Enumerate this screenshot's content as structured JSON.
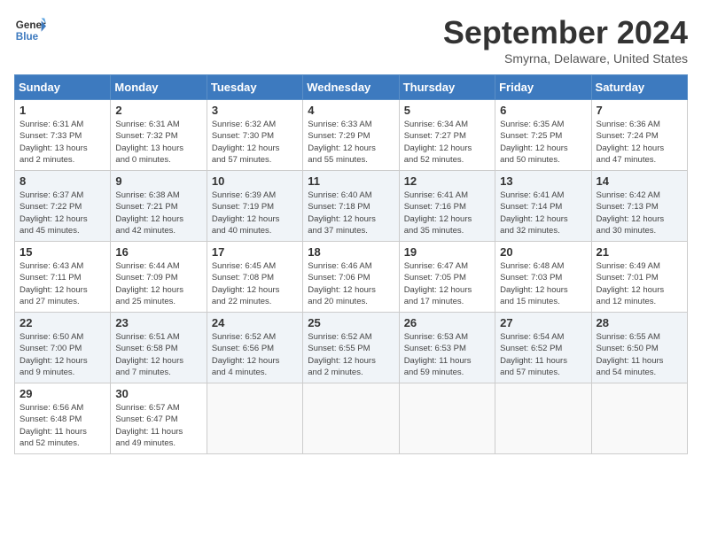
{
  "logo": {
    "line1": "General",
    "line2": "Blue"
  },
  "title": "September 2024",
  "location": "Smyrna, Delaware, United States",
  "days_of_week": [
    "Sunday",
    "Monday",
    "Tuesday",
    "Wednesday",
    "Thursday",
    "Friday",
    "Saturday"
  ],
  "weeks": [
    [
      {
        "day": "1",
        "info": "Sunrise: 6:31 AM\nSunset: 7:33 PM\nDaylight: 13 hours\nand 2 minutes."
      },
      {
        "day": "2",
        "info": "Sunrise: 6:31 AM\nSunset: 7:32 PM\nDaylight: 13 hours\nand 0 minutes."
      },
      {
        "day": "3",
        "info": "Sunrise: 6:32 AM\nSunset: 7:30 PM\nDaylight: 12 hours\nand 57 minutes."
      },
      {
        "day": "4",
        "info": "Sunrise: 6:33 AM\nSunset: 7:29 PM\nDaylight: 12 hours\nand 55 minutes."
      },
      {
        "day": "5",
        "info": "Sunrise: 6:34 AM\nSunset: 7:27 PM\nDaylight: 12 hours\nand 52 minutes."
      },
      {
        "day": "6",
        "info": "Sunrise: 6:35 AM\nSunset: 7:25 PM\nDaylight: 12 hours\nand 50 minutes."
      },
      {
        "day": "7",
        "info": "Sunrise: 6:36 AM\nSunset: 7:24 PM\nDaylight: 12 hours\nand 47 minutes."
      }
    ],
    [
      {
        "day": "8",
        "info": "Sunrise: 6:37 AM\nSunset: 7:22 PM\nDaylight: 12 hours\nand 45 minutes."
      },
      {
        "day": "9",
        "info": "Sunrise: 6:38 AM\nSunset: 7:21 PM\nDaylight: 12 hours\nand 42 minutes."
      },
      {
        "day": "10",
        "info": "Sunrise: 6:39 AM\nSunset: 7:19 PM\nDaylight: 12 hours\nand 40 minutes."
      },
      {
        "day": "11",
        "info": "Sunrise: 6:40 AM\nSunset: 7:18 PM\nDaylight: 12 hours\nand 37 minutes."
      },
      {
        "day": "12",
        "info": "Sunrise: 6:41 AM\nSunset: 7:16 PM\nDaylight: 12 hours\nand 35 minutes."
      },
      {
        "day": "13",
        "info": "Sunrise: 6:41 AM\nSunset: 7:14 PM\nDaylight: 12 hours\nand 32 minutes."
      },
      {
        "day": "14",
        "info": "Sunrise: 6:42 AM\nSunset: 7:13 PM\nDaylight: 12 hours\nand 30 minutes."
      }
    ],
    [
      {
        "day": "15",
        "info": "Sunrise: 6:43 AM\nSunset: 7:11 PM\nDaylight: 12 hours\nand 27 minutes."
      },
      {
        "day": "16",
        "info": "Sunrise: 6:44 AM\nSunset: 7:09 PM\nDaylight: 12 hours\nand 25 minutes."
      },
      {
        "day": "17",
        "info": "Sunrise: 6:45 AM\nSunset: 7:08 PM\nDaylight: 12 hours\nand 22 minutes."
      },
      {
        "day": "18",
        "info": "Sunrise: 6:46 AM\nSunset: 7:06 PM\nDaylight: 12 hours\nand 20 minutes."
      },
      {
        "day": "19",
        "info": "Sunrise: 6:47 AM\nSunset: 7:05 PM\nDaylight: 12 hours\nand 17 minutes."
      },
      {
        "day": "20",
        "info": "Sunrise: 6:48 AM\nSunset: 7:03 PM\nDaylight: 12 hours\nand 15 minutes."
      },
      {
        "day": "21",
        "info": "Sunrise: 6:49 AM\nSunset: 7:01 PM\nDaylight: 12 hours\nand 12 minutes."
      }
    ],
    [
      {
        "day": "22",
        "info": "Sunrise: 6:50 AM\nSunset: 7:00 PM\nDaylight: 12 hours\nand 9 minutes."
      },
      {
        "day": "23",
        "info": "Sunrise: 6:51 AM\nSunset: 6:58 PM\nDaylight: 12 hours\nand 7 minutes."
      },
      {
        "day": "24",
        "info": "Sunrise: 6:52 AM\nSunset: 6:56 PM\nDaylight: 12 hours\nand 4 minutes."
      },
      {
        "day": "25",
        "info": "Sunrise: 6:52 AM\nSunset: 6:55 PM\nDaylight: 12 hours\nand 2 minutes."
      },
      {
        "day": "26",
        "info": "Sunrise: 6:53 AM\nSunset: 6:53 PM\nDaylight: 11 hours\nand 59 minutes."
      },
      {
        "day": "27",
        "info": "Sunrise: 6:54 AM\nSunset: 6:52 PM\nDaylight: 11 hours\nand 57 minutes."
      },
      {
        "day": "28",
        "info": "Sunrise: 6:55 AM\nSunset: 6:50 PM\nDaylight: 11 hours\nand 54 minutes."
      }
    ],
    [
      {
        "day": "29",
        "info": "Sunrise: 6:56 AM\nSunset: 6:48 PM\nDaylight: 11 hours\nand 52 minutes."
      },
      {
        "day": "30",
        "info": "Sunrise: 6:57 AM\nSunset: 6:47 PM\nDaylight: 11 hours\nand 49 minutes."
      },
      {
        "day": "",
        "info": ""
      },
      {
        "day": "",
        "info": ""
      },
      {
        "day": "",
        "info": ""
      },
      {
        "day": "",
        "info": ""
      },
      {
        "day": "",
        "info": ""
      }
    ]
  ]
}
